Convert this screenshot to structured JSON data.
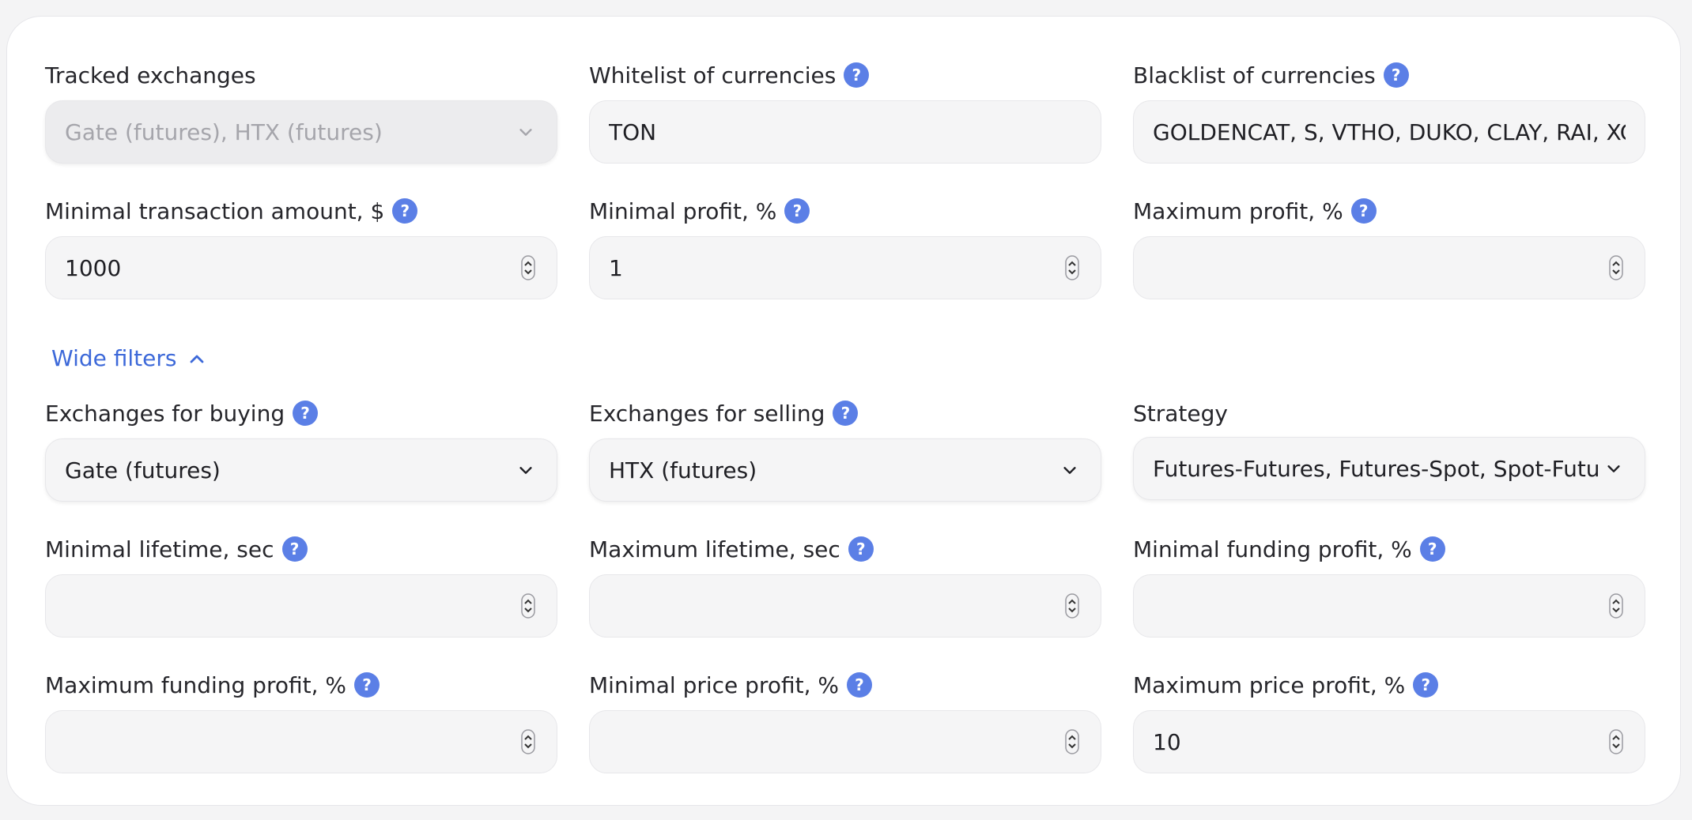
{
  "filters": {
    "tracked_exchanges": {
      "label": "Tracked exchanges",
      "value": "Gate (futures), HTX (futures)"
    },
    "whitelist": {
      "label": "Whitelist of currencies",
      "value": "TON"
    },
    "blacklist": {
      "label": "Blacklist of currencies",
      "value": "GOLDENCAT, S, VTHO, DUKO, CLAY, RAI, XCH"
    },
    "min_transaction": {
      "label": "Minimal transaction amount, $",
      "value": "1000"
    },
    "min_profit": {
      "label": "Minimal profit, %",
      "value": "1"
    },
    "max_profit": {
      "label": "Maximum profit, %",
      "value": ""
    }
  },
  "wide_filters": {
    "toggle_label": "Wide filters",
    "exchanges_buying": {
      "label": "Exchanges for buying",
      "value": "Gate (futures)"
    },
    "exchanges_selling": {
      "label": "Exchanges for selling",
      "value": "HTX (futures)"
    },
    "strategy": {
      "label": "Strategy",
      "value": "Futures-Futures, Futures-Spot, Spot-Futures"
    },
    "min_lifetime": {
      "label": "Minimal lifetime, sec",
      "value": ""
    },
    "max_lifetime": {
      "label": "Maximum lifetime, sec",
      "value": ""
    },
    "min_funding_profit": {
      "label": "Minimal funding profit, %",
      "value": ""
    },
    "max_funding_profit": {
      "label": "Maximum funding profit, %",
      "value": ""
    },
    "min_price_profit": {
      "label": "Minimal price profit, %",
      "value": ""
    },
    "max_price_profit": {
      "label": "Maximum price profit, %",
      "value": "10"
    }
  },
  "help_glyph": "?",
  "colors": {
    "accent": "#3d69d9",
    "help_badge": "#5b7fe6",
    "field_bg": "#f5f5f6"
  }
}
